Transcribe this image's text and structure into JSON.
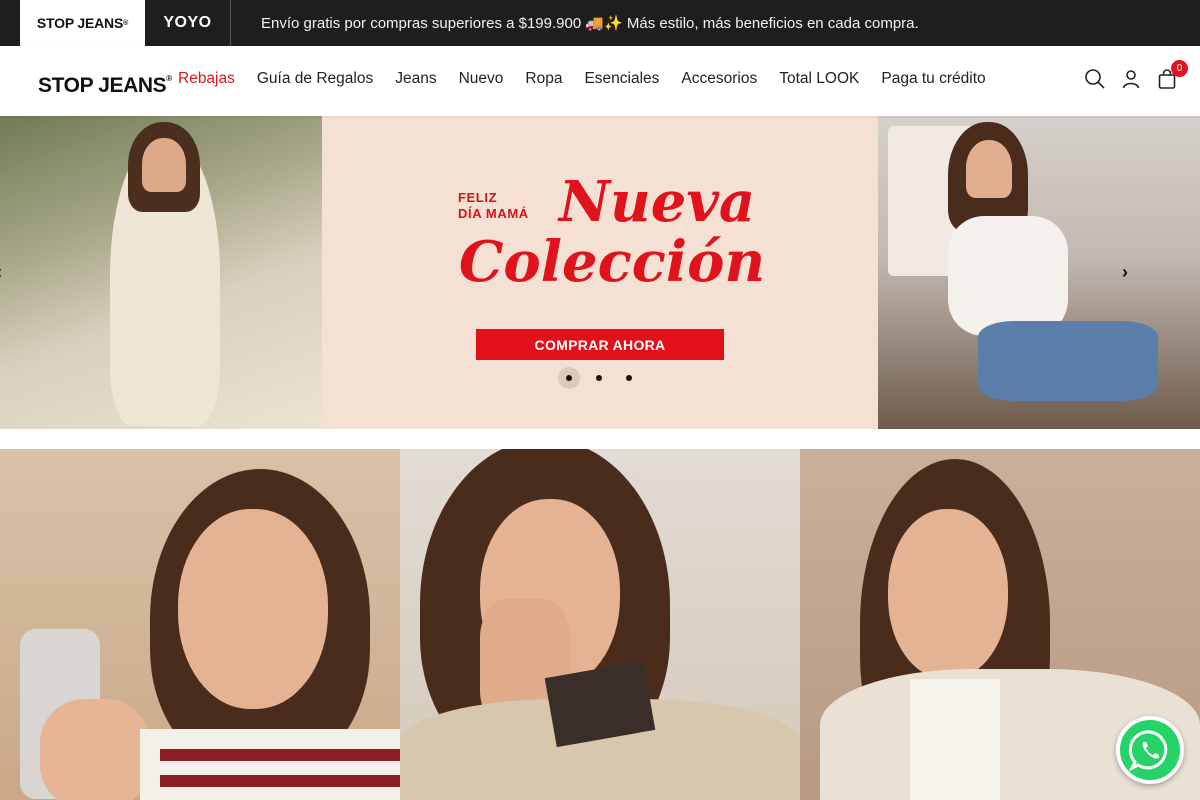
{
  "topbar": {
    "brand_1": "STOP JEANS",
    "brand_2": "YOYO",
    "announcement": "Envío gratis por compras superiores a $199.900 🚚✨ Más estilo, más beneficios en cada compra."
  },
  "header": {
    "logo": "STOP JEANS",
    "nav": [
      {
        "label": "Rebajas"
      },
      {
        "label": "Guía de Regalos"
      },
      {
        "label": "Jeans"
      },
      {
        "label": "Nuevo"
      },
      {
        "label": "Ropa"
      },
      {
        "label": "Esenciales"
      },
      {
        "label": "Accesorios"
      },
      {
        "label": "Total LOOK"
      },
      {
        "label": "Paga tu crédito"
      }
    ],
    "icons": [
      "search-icon",
      "user-icon",
      "bag-icon"
    ],
    "cart_count": "0"
  },
  "hero": {
    "eyebrow_1": "FELIZ",
    "eyebrow_2": "DÍA MAMÁ",
    "headline_1": "Nueva",
    "headline_2": "Colección",
    "cta": "COMPRAR AHORA",
    "slides": 3,
    "active_slide": 1,
    "accent": "#e0131c"
  },
  "colors": {
    "topbar_bg": "#1e1e1e",
    "sale": "#e0151f",
    "whatsapp": "#25d366"
  }
}
